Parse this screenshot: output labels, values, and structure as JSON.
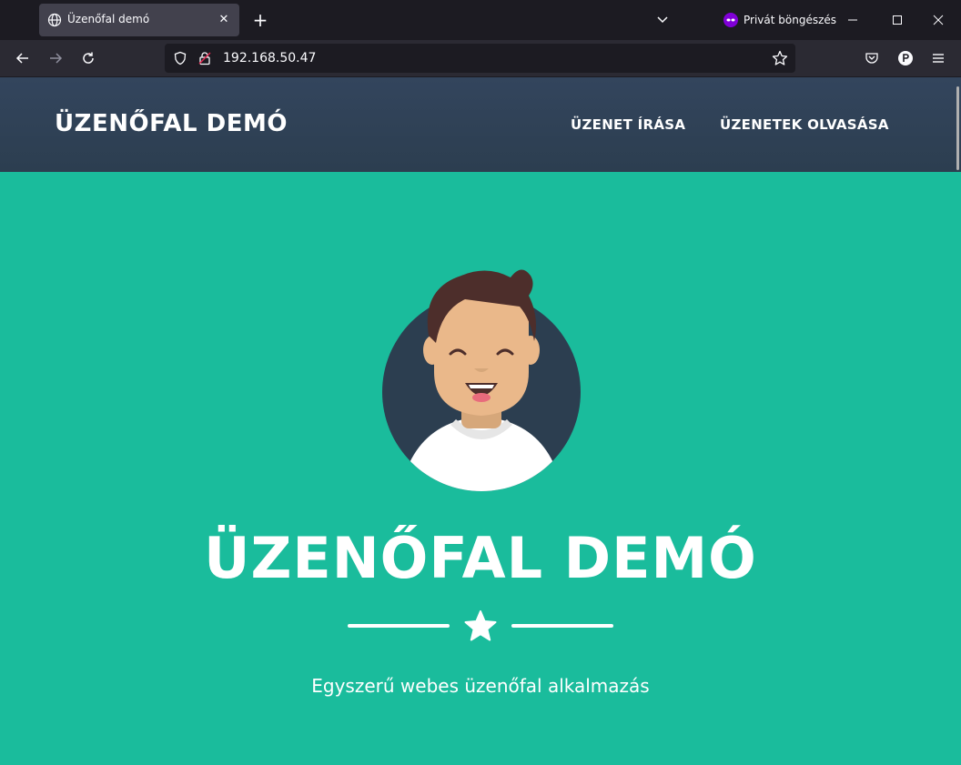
{
  "browser": {
    "tab_title": "Üzenőfal demó",
    "tab_close": "✕",
    "new_tab": "+",
    "private_label": "Privát böngészés",
    "url": "192.168.50.47"
  },
  "site": {
    "brand": "ÜZENŐFAL DEMÓ",
    "nav": [
      "ÜZENET ÍRÁSA",
      "ÜZENETEK OLVASÁSA"
    ],
    "hero_title": "ÜZENŐFAL DEMÓ",
    "subtitle": "Egyszerű webes üzenőfal alkalmazás"
  },
  "colors": {
    "header": "#2c3e50",
    "hero": "#1abc9c",
    "private_accent": "#8000d7"
  }
}
